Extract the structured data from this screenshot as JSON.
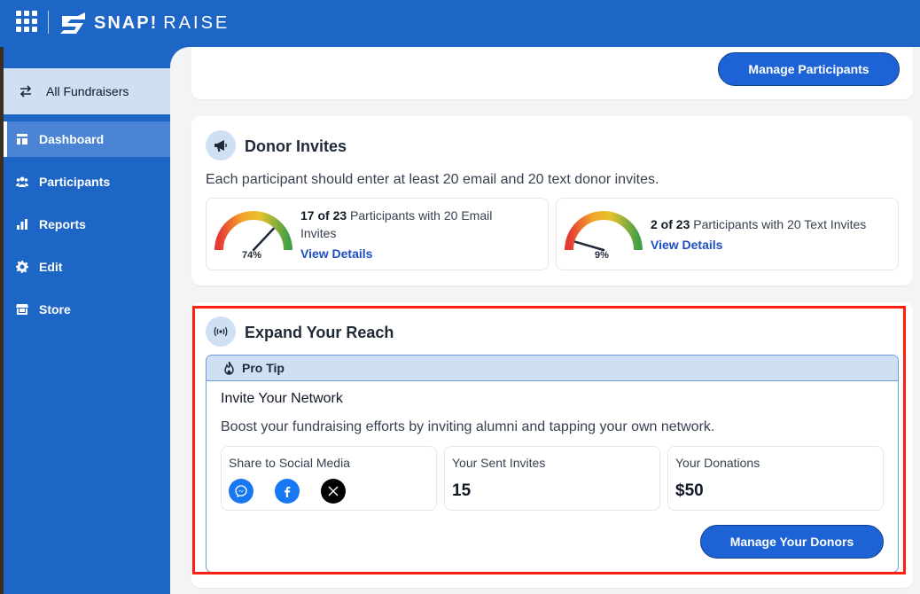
{
  "app": {
    "brand_primary": "SNAP!",
    "brand_secondary": "RAISE"
  },
  "sidebar": {
    "switcher_label": "All Fundraisers",
    "items": [
      {
        "label": "Dashboard",
        "icon": "dashboard-icon",
        "active": true
      },
      {
        "label": "Participants",
        "icon": "participants-icon",
        "active": false
      },
      {
        "label": "Reports",
        "icon": "reports-icon",
        "active": false
      },
      {
        "label": "Edit",
        "icon": "gear-icon",
        "active": false
      },
      {
        "label": "Store",
        "icon": "store-icon",
        "active": false
      }
    ]
  },
  "participants_card": {
    "button_label": "Manage Participants"
  },
  "donor_invites": {
    "title": "Donor Invites",
    "description": "Each participant should enter at least 20 email and 20 text donor invites.",
    "email": {
      "pct_label": "74%",
      "pct": 0.74,
      "count": "17 of 23",
      "text": " Participants with 20 Email Invites",
      "link": "View Details"
    },
    "text": {
      "pct_label": "9%",
      "pct": 0.09,
      "count": "2 of 23",
      "text": " Participants with 20 Text Invites",
      "link": "View Details"
    }
  },
  "expand_reach": {
    "title": "Expand Your Reach",
    "protip_label": "Pro Tip",
    "invite_title": "Invite Your Network",
    "invite_desc": "Boost your fundraising efforts by inviting alumni and tapping your own network.",
    "share_label": "Share to Social Media",
    "sent_label": "Your Sent Invites",
    "sent_value": "15",
    "donations_label": "Your Donations",
    "donations_value": "$50",
    "button_label": "Manage Your Donors"
  },
  "colors": {
    "accent": "#1d63d6",
    "sidebar": "#1e66c6",
    "highlight": "#ff1e10",
    "messenger": "#1877f2",
    "facebook": "#1877f2",
    "x": "#000000"
  }
}
